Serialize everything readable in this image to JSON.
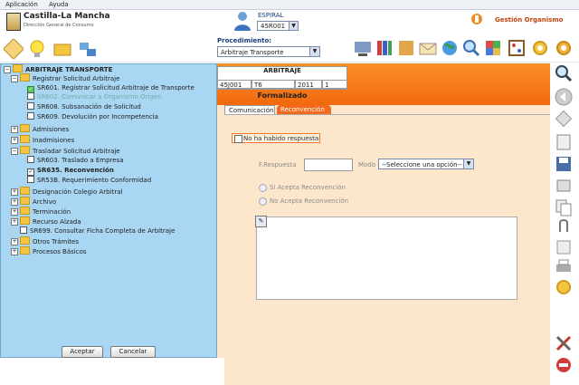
{
  "menubar": {
    "items": [
      "Aplicación",
      "Ayuda"
    ]
  },
  "header": {
    "logo_title": "Castilla-La Mancha",
    "logo_sub": "Dirección General de Consumo",
    "espiral_label": "ESPIRAL",
    "espiral_value": "45R001",
    "gestion_label": "Gestión Organismo"
  },
  "procedimiento": {
    "label": "Procedimiento:",
    "value": "Arbitraje Transporte"
  },
  "arbitraje": {
    "title": "ARBITRAJE",
    "cells": [
      "45J001",
      "T6",
      "2011",
      "1"
    ],
    "status": "Formalizado"
  },
  "tabs": {
    "comunicacion": "Comunicación",
    "reconvencion": "Reconvención"
  },
  "form": {
    "no_respuesta": "No ha habido respuesta",
    "fresp_label": "F.Respuesta",
    "modo_label": "Modo",
    "modo_value": "--Seleccione una opción--",
    "radio_acepta": "Si Acepta Reconvención",
    "radio_no_acepta": "No Acepta Reconvención"
  },
  "tree": {
    "root": "ARBITRAJE TRANSPORTE",
    "registrar": "Registrar Solicitud Arbitraje",
    "sr601": "SR601. Registrar Solicitud Arbitraje de Transporte",
    "sr602": "SR602. Comunicar a Organismo Origen",
    "sr608": "SR608. Subsanación de Solicitud",
    "sr609": "SR609. Devolución por Incompetencia",
    "admisiones": "Admisiones",
    "inadmisiones": "Inadmisiones",
    "trasladar": "Trasladar Solicitud Arbitraje",
    "sr603": "SR603. Traslado a Empresa",
    "sr635": "SR635. Reconvención",
    "sr53b": "SR53B. Requerimiento Conformidad",
    "designacion": "Designación Colegio Arbitral",
    "archivo": "Archivo",
    "terminacion": "Terminación",
    "recurso": "Recurso Alzada",
    "sr699": "SR699. Consultar Ficha Completa de Arbitraje",
    "otros": "Otros Trámites",
    "procesos": "Procesos Básicos",
    "aceptar": "Aceptar",
    "cancelar": "Cancelar"
  },
  "colors": {
    "orange": "#f16a0d",
    "panel": "#fde7cc",
    "tree_bg": "#a9d6f2"
  }
}
